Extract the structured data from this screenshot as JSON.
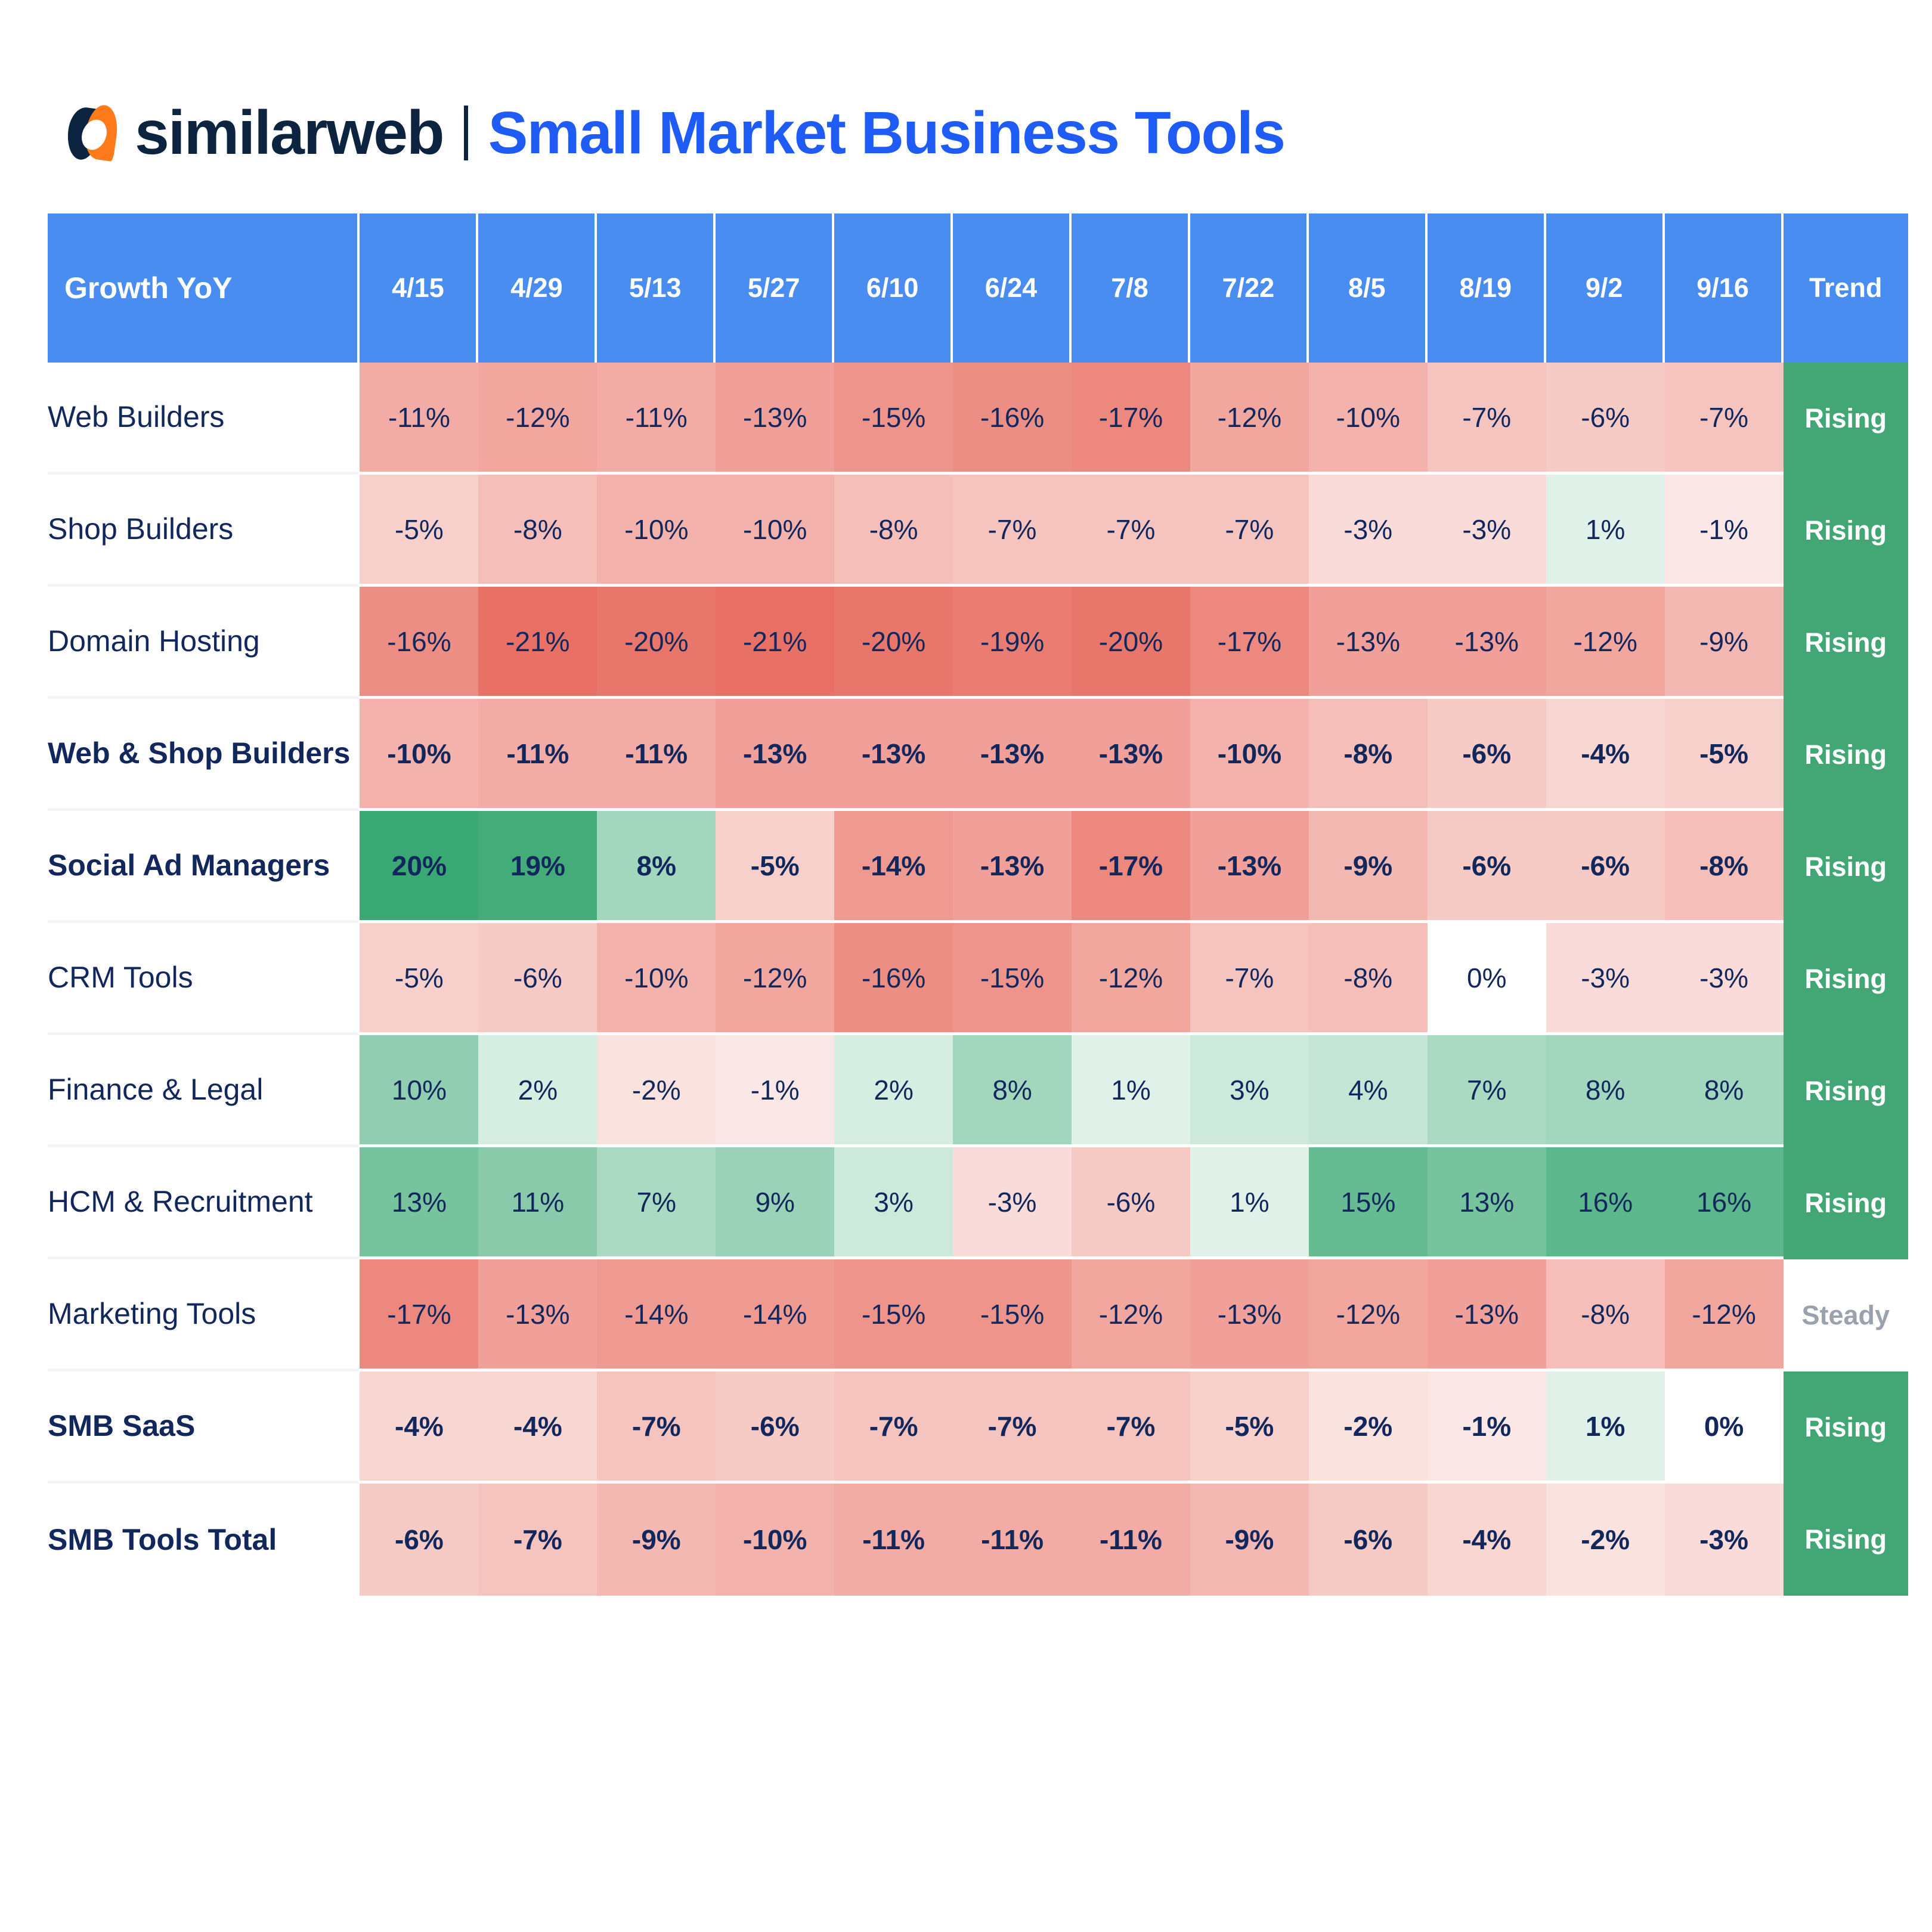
{
  "brand": {
    "name": "similarweb",
    "logo_icon": "similarweb-droplet-logo"
  },
  "header": {
    "title": "Small Market Business Tools"
  },
  "table": {
    "label_header": "Growth YoY",
    "trend_header": "Trend",
    "date_columns": [
      "4/15",
      "4/29",
      "5/13",
      "5/27",
      "6/10",
      "6/24",
      "7/8",
      "7/22",
      "8/5",
      "8/19",
      "9/2",
      "9/16"
    ],
    "header_bg": "#4a8df0",
    "positive_color": "#3aa873",
    "negative_color": "#e8766a",
    "trend_rising_bg": "#42a775",
    "trend_steady_color": "#9aa2ad",
    "text_color": "#12275c"
  },
  "chart_data": {
    "type": "heatmap",
    "title": "Small Market Business Tools",
    "xlabel": "Growth YoY",
    "ylabel": "",
    "categories": [
      "4/15",
      "4/29",
      "5/13",
      "5/27",
      "6/10",
      "6/24",
      "7/8",
      "7/22",
      "8/5",
      "8/19",
      "9/2",
      "9/16"
    ],
    "value_unit": "%",
    "value_range": [
      -21,
      20
    ],
    "grid": false,
    "legend": "none",
    "series": [
      {
        "name": "Web Builders",
        "bold": false,
        "trend": "Rising",
        "values": [
          -11,
          -12,
          -11,
          -13,
          -15,
          -16,
          -17,
          -12,
          -10,
          -7,
          -6,
          -7
        ]
      },
      {
        "name": "Shop Builders",
        "bold": false,
        "trend": "Rising",
        "values": [
          -5,
          -8,
          -10,
          -10,
          -8,
          -7,
          -7,
          -7,
          -3,
          -3,
          1,
          -1
        ]
      },
      {
        "name": "Domain Hosting",
        "bold": false,
        "trend": "Rising",
        "values": [
          -16,
          -21,
          -20,
          -21,
          -20,
          -19,
          -20,
          -17,
          -13,
          -13,
          -12,
          -9
        ]
      },
      {
        "name": "Web & Shop Builders",
        "bold": true,
        "trend": "Rising",
        "values": [
          -10,
          -11,
          -11,
          -13,
          -13,
          -13,
          -13,
          -10,
          -8,
          -6,
          -4,
          -5
        ]
      },
      {
        "name": "Social Ad Managers",
        "bold": true,
        "trend": "Rising",
        "values": [
          20,
          19,
          8,
          -5,
          -14,
          -13,
          -17,
          -13,
          -9,
          -6,
          -6,
          -8
        ]
      },
      {
        "name": "CRM Tools",
        "bold": false,
        "trend": "Rising",
        "values": [
          -5,
          -6,
          -10,
          -12,
          -16,
          -15,
          -12,
          -7,
          -8,
          0,
          -3,
          -3
        ]
      },
      {
        "name": "Finance & Legal",
        "bold": false,
        "trend": "Rising",
        "values": [
          10,
          2,
          -2,
          -1,
          2,
          8,
          1,
          3,
          4,
          7,
          8,
          8
        ]
      },
      {
        "name": "HCM & Recruitment",
        "bold": false,
        "trend": "Rising",
        "values": [
          13,
          11,
          7,
          9,
          3,
          -3,
          -6,
          1,
          15,
          13,
          16,
          16
        ]
      },
      {
        "name": "Marketing Tools",
        "bold": false,
        "trend": "Steady",
        "values": [
          -17,
          -13,
          -14,
          -14,
          -15,
          -15,
          -12,
          -13,
          -12,
          -13,
          -8,
          -12
        ]
      },
      {
        "name": "SMB SaaS",
        "bold": true,
        "trend": "Rising",
        "values": [
          -4,
          -4,
          -7,
          -6,
          -7,
          -7,
          -7,
          -5,
          -2,
          -1,
          1,
          0
        ]
      },
      {
        "name": "SMB Tools Total",
        "bold": true,
        "trend": "Rising",
        "values": [
          -6,
          -7,
          -9,
          -10,
          -11,
          -11,
          -11,
          -9,
          -6,
          -4,
          -2,
          -3
        ]
      }
    ]
  }
}
